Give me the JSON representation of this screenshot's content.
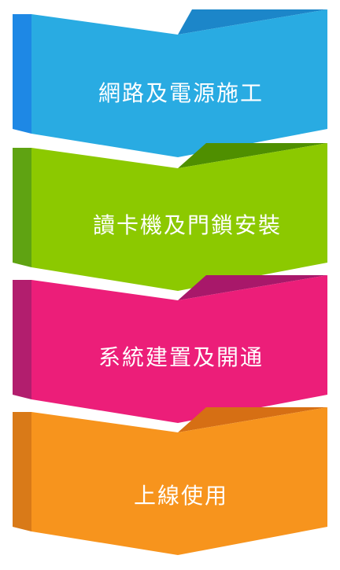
{
  "steps": [
    {
      "label": "網路及電源施工",
      "colors": {
        "main": "#29ABE2",
        "side": "#1E88E5",
        "top": "#1C86C9"
      }
    },
    {
      "label": "讀卡機及門鎖安裝",
      "colors": {
        "main": "#8CC900",
        "side": "#5FA312",
        "top": "#4F8F00"
      }
    },
    {
      "label": "系統建置及開通",
      "colors": {
        "main": "#EC1E79",
        "side": "#B21E6E",
        "top": "#A8186A"
      }
    },
    {
      "label": "上線使用",
      "colors": {
        "main": "#F7941D",
        "side": "#D97A18",
        "top": "#D66F14"
      }
    }
  ]
}
